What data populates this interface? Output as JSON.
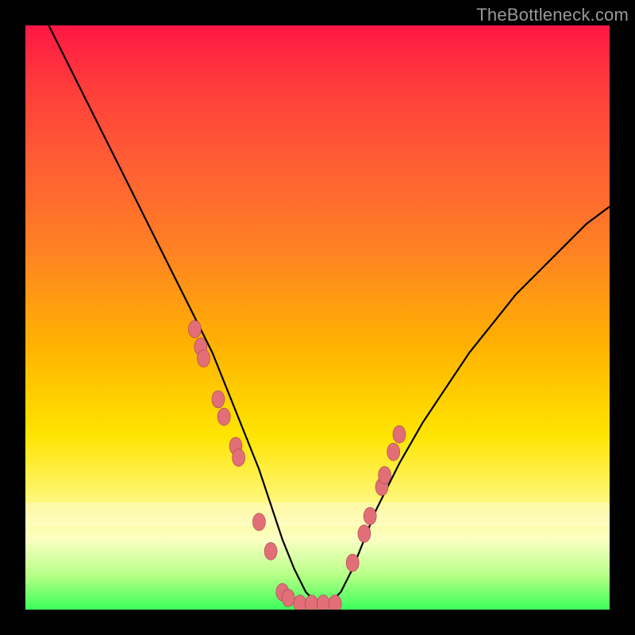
{
  "watermark": "TheBottleneck.com",
  "colors": {
    "background_frame": "#000000",
    "curve": "#000000",
    "marker_fill": "#e26f77",
    "marker_stroke": "#a3414c",
    "gradient_top": "#ff1744",
    "gradient_bottom": "#3bff5a"
  },
  "chart_data": {
    "type": "line",
    "title": "",
    "xlabel": "",
    "ylabel": "",
    "xlim": [
      0,
      100
    ],
    "ylim": [
      0,
      100
    ],
    "grid": false,
    "legend": false,
    "notes": "V-shaped bottleneck curve on rainbow gradient; no axis ticks or labels visible. Y≈0 is optimal (green), Y near 100 is worst (red). Marker points cluster near the valley.",
    "series": [
      {
        "name": "bottleneck-curve",
        "x": [
          4,
          8,
          12,
          16,
          20,
          24,
          28,
          32,
          36,
          38,
          40,
          42,
          44,
          46,
          48,
          50,
          52,
          54,
          56,
          58,
          60,
          64,
          68,
          72,
          76,
          80,
          84,
          88,
          92,
          96,
          100
        ],
        "y": [
          100,
          92,
          84,
          76,
          68,
          60,
          52,
          44,
          34,
          29,
          24,
          18,
          12,
          7,
          3,
          1,
          1,
          3,
          7,
          12,
          17,
          25,
          32,
          38,
          44,
          49,
          54,
          58,
          62,
          66,
          69
        ]
      }
    ],
    "markers": [
      {
        "x": 29,
        "y": 48
      },
      {
        "x": 30,
        "y": 45
      },
      {
        "x": 30.5,
        "y": 43
      },
      {
        "x": 33,
        "y": 36
      },
      {
        "x": 34,
        "y": 33
      },
      {
        "x": 36,
        "y": 28
      },
      {
        "x": 36.5,
        "y": 26
      },
      {
        "x": 40,
        "y": 15
      },
      {
        "x": 42,
        "y": 10
      },
      {
        "x": 44,
        "y": 3
      },
      {
        "x": 45,
        "y": 2
      },
      {
        "x": 47,
        "y": 1
      },
      {
        "x": 49,
        "y": 1
      },
      {
        "x": 51,
        "y": 1
      },
      {
        "x": 53,
        "y": 1
      },
      {
        "x": 56,
        "y": 8
      },
      {
        "x": 58,
        "y": 13
      },
      {
        "x": 59,
        "y": 16
      },
      {
        "x": 61,
        "y": 21
      },
      {
        "x": 61.5,
        "y": 23
      },
      {
        "x": 63,
        "y": 27
      },
      {
        "x": 64,
        "y": 30
      }
    ]
  }
}
